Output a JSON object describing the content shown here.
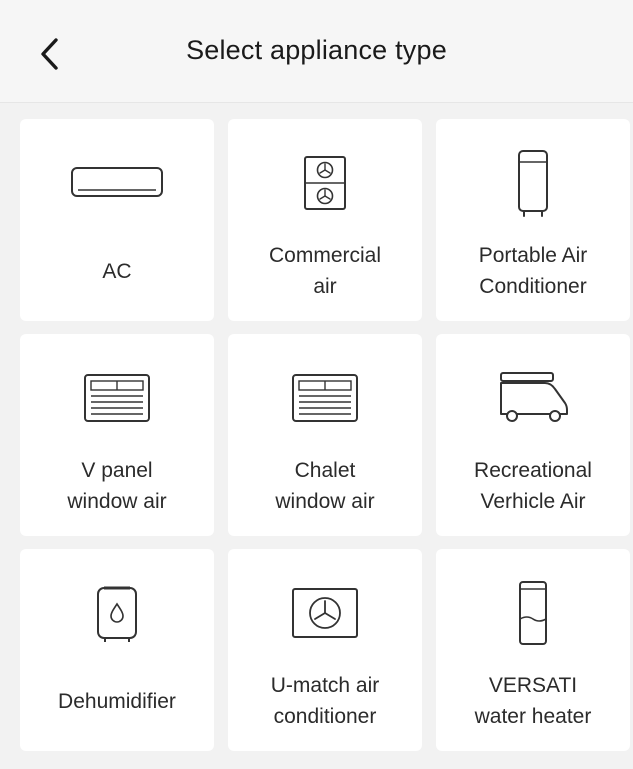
{
  "header": {
    "title": "Select appliance type"
  },
  "appliances": [
    {
      "label": "AC",
      "icon": "wall-ac-icon"
    },
    {
      "label": "Commercial\nair",
      "icon": "commercial-air-icon"
    },
    {
      "label": "Portable Air\nConditioner",
      "icon": "portable-ac-icon"
    },
    {
      "label": "V panel\nwindow air",
      "icon": "window-ac-icon"
    },
    {
      "label": "Chalet\nwindow air",
      "icon": "window-ac-icon"
    },
    {
      "label": "Recreational\nVerhicle Air",
      "icon": "rv-air-icon"
    },
    {
      "label": "Dehumidifier",
      "icon": "dehumidifier-icon"
    },
    {
      "label": "U-match air\nconditioner",
      "icon": "outdoor-unit-icon"
    },
    {
      "label": "VERSATI\nwater heater",
      "icon": "water-heater-icon"
    }
  ],
  "colors": {
    "background": "#f2f2f2",
    "card": "#ffffff",
    "icon_stroke": "#333333",
    "text": "#2b2b2b"
  }
}
